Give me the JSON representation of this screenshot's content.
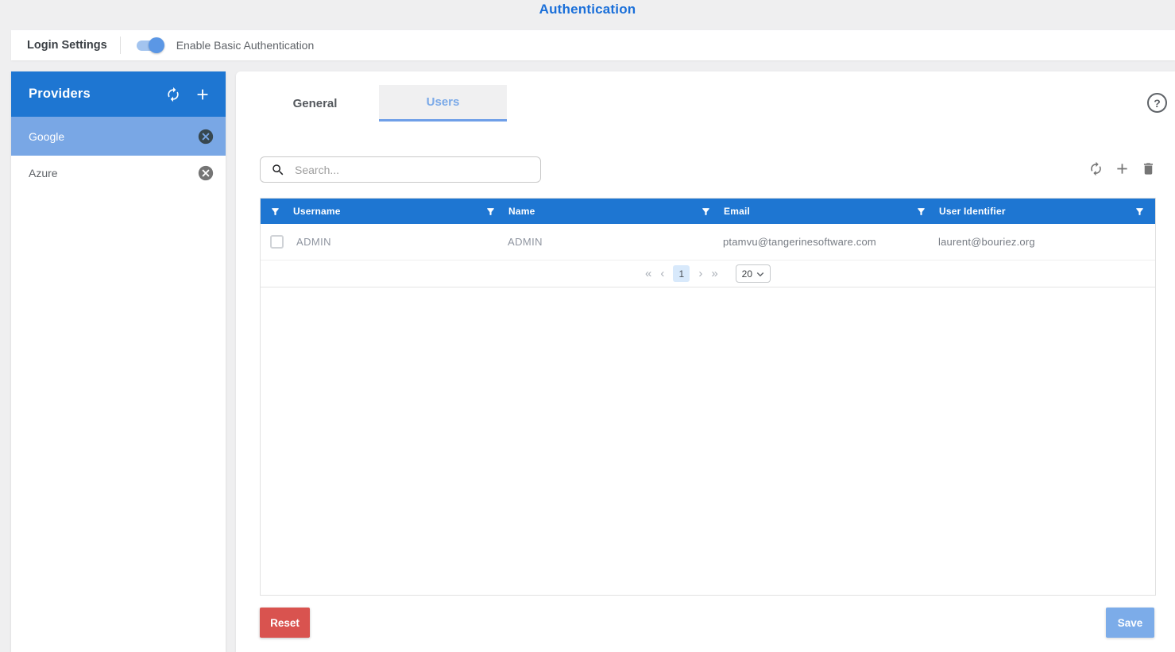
{
  "page": {
    "title": "Authentication"
  },
  "login_bar": {
    "label": "Login Settings",
    "toggle_label": "Enable Basic Authentication",
    "toggle_state": "on"
  },
  "sidebar": {
    "title": "Providers",
    "items": [
      {
        "label": "Google",
        "selected": true
      },
      {
        "label": "Azure",
        "selected": false
      }
    ]
  },
  "main": {
    "tabs": [
      {
        "label": "General",
        "active": false
      },
      {
        "label": "Users",
        "active": true
      }
    ],
    "help_glyph": "?",
    "search": {
      "placeholder": "Search...",
      "value": ""
    },
    "table": {
      "columns": [
        "Username",
        "Name",
        "Email",
        "User Identifier"
      ],
      "rows": [
        {
          "username": "ADMIN",
          "name": "ADMIN",
          "email": "ptamvu@tangerinesoftware.com",
          "user_identifier": "laurent@bouriez.org"
        }
      ]
    },
    "pagination": {
      "first": "«",
      "prev": "‹",
      "current_page": "1",
      "next": "›",
      "last": "»",
      "page_size": "20"
    },
    "actions": {
      "reset": "Reset",
      "save": "Save"
    }
  },
  "icons": {
    "sync": "circular-two-arrows",
    "add": "plus",
    "remove_provider": "circle-x",
    "search": "magnifier",
    "help": "question-circle",
    "filter": "funnel",
    "delete": "trash-can",
    "select_chevron": "chevron-down"
  },
  "colors": {
    "accent_blue": "#1e76d2",
    "title_blue": "#1a6fd9",
    "selected_item_blue": "#79a7e5",
    "active_tab_blue": "#7aa9e8",
    "save_blue": "#7cace9",
    "danger_red": "#d9534f",
    "pagination_active_bg": "#d8e9fb",
    "page_bg": "#efeff0"
  }
}
